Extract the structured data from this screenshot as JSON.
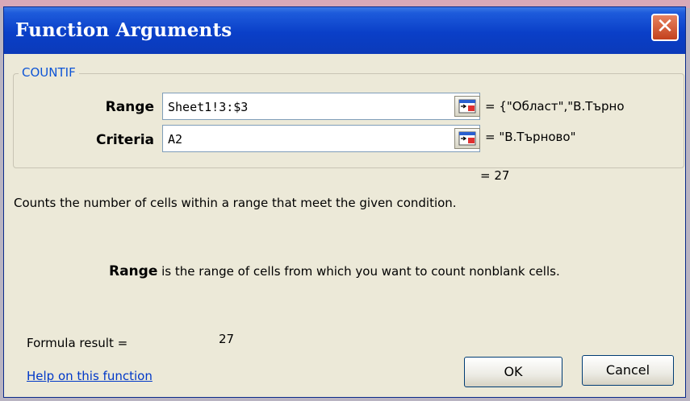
{
  "window": {
    "title": "Function Arguments",
    "close_symbol": "✕"
  },
  "function": {
    "name": "COUNTIF",
    "args": [
      {
        "label": "Range",
        "value": "Sheet1!3:$3",
        "evaluated": "= {\"Област\",\"В.Търно"
      },
      {
        "label": "Criteria",
        "value": "A2",
        "evaluated": "= \"В.Търново\""
      }
    ],
    "result_preview": "= 27",
    "description": "Counts the number of cells within a range that meet the given condition.",
    "arg_help_name": "Range",
    "arg_help_text": " is the range of cells from which you want to count nonblank cells."
  },
  "footer": {
    "formula_result_label": "Formula result =",
    "formula_result_value": "27",
    "help_link": "Help on this function",
    "ok_label": "OK",
    "cancel_label": "Cancel"
  },
  "icons": {
    "collapse": "collapse-dialog-icon",
    "close": "close-icon"
  },
  "colors": {
    "titlebar": "#0b3ab9",
    "close": "#c3411d",
    "dialog": "#ece9d8",
    "link": "#0038c8"
  }
}
